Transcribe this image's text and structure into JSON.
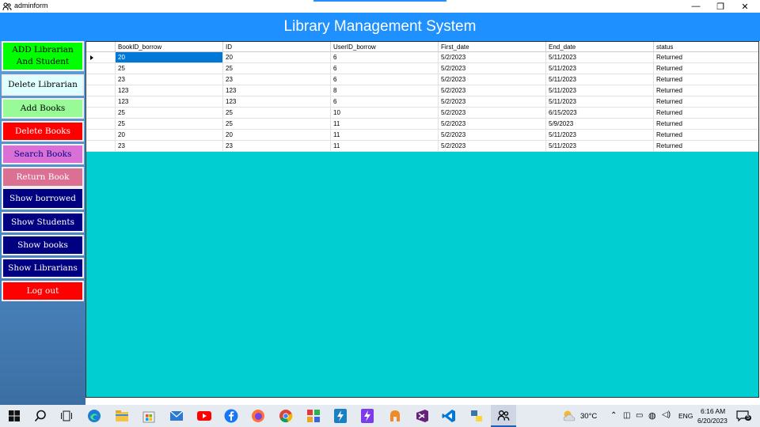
{
  "window": {
    "title": "adminform",
    "minimize": "—",
    "maximize": "❐",
    "close": "✕"
  },
  "header": {
    "title": "Library Management System"
  },
  "sidebar": {
    "buttons": [
      {
        "label": "ADD Librarian\nAnd Student",
        "bg": "#00ff00",
        "fg": "#000000"
      },
      {
        "label": "Delete Librarian",
        "bg": "#e0ffff",
        "fg": "#000000"
      },
      {
        "label": "Add Books",
        "bg": "#98fb98",
        "fg": "#000000"
      },
      {
        "label": "Delete Books",
        "bg": "#ff0000",
        "fg": "#ffffff"
      },
      {
        "label": "Search Books",
        "bg": "#da70d6",
        "fg": "#000080"
      },
      {
        "label": "Return Book",
        "bg": "#db7093",
        "fg": "#ffffff"
      },
      {
        "label": "Show borrowed",
        "bg": "#000080",
        "fg": "#ffffff"
      },
      {
        "label": "Show Students",
        "bg": "#000080",
        "fg": "#ffffff"
      },
      {
        "label": "Show books",
        "bg": "#000080",
        "fg": "#ffffff"
      },
      {
        "label": "Show Librarians",
        "bg": "#000080",
        "fg": "#ffffff"
      },
      {
        "label": "Log out",
        "bg": "#ff0000",
        "fg": "#ffffff"
      }
    ]
  },
  "grid": {
    "columns": [
      "BookID_borrow",
      "ID",
      "UserID_borrow",
      "First_date",
      "End_date",
      "status"
    ],
    "rows": [
      [
        "20",
        "20",
        "6",
        "5/2/2023",
        "5/11/2023",
        "Returned"
      ],
      [
        "25",
        "25",
        "6",
        "5/2/2023",
        "5/11/2023",
        "Returned"
      ],
      [
        "23",
        "23",
        "6",
        "5/2/2023",
        "5/11/2023",
        "Returned"
      ],
      [
        "123",
        "123",
        "8",
        "5/2/2023",
        "5/11/2023",
        "Returned"
      ],
      [
        "123",
        "123",
        "6",
        "5/2/2023",
        "5/11/2023",
        "Returned"
      ],
      [
        "25",
        "25",
        "10",
        "5/2/2023",
        "6/15/2023",
        "Returned"
      ],
      [
        "25",
        "25",
        "11",
        "5/2/2023",
        "5/9/2023",
        "Returned"
      ],
      [
        "20",
        "20",
        "11",
        "5/2/2023",
        "5/11/2023",
        "Returned"
      ],
      [
        "23",
        "23",
        "11",
        "5/2/2023",
        "5/11/2023",
        "Returned"
      ]
    ],
    "selected_row": 0,
    "background": "#00ced1"
  },
  "taskbar": {
    "apps": [
      "windows-icon",
      "search-icon",
      "task-view-icon",
      "edge-icon",
      "file-explorer-icon",
      "store-icon",
      "mail-icon",
      "youtube-icon",
      "facebook-icon",
      "firefox-icon",
      "chrome-icon",
      "app-grid-icon",
      "power-automate-icon",
      "power-apps-icon",
      "github-icon",
      "visual-studio-icon",
      "vscode-icon",
      "python-icon",
      "adminform-icon"
    ],
    "weather": "30°C",
    "language": "ENG",
    "time": "6:16 AM",
    "date": "6/20/2023",
    "notifications": "5"
  }
}
